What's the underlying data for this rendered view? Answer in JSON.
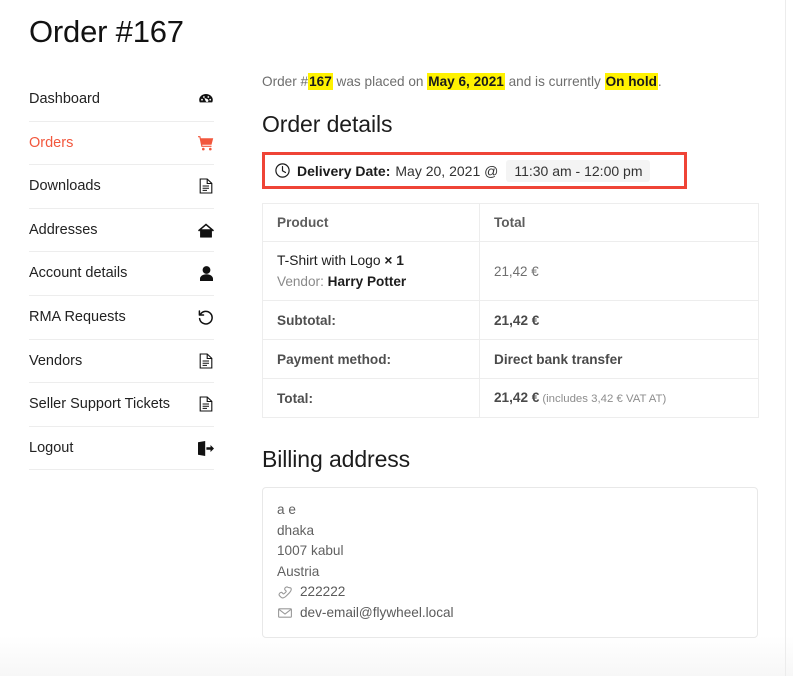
{
  "page_title": "Order #167",
  "sidebar": {
    "items": [
      {
        "label": "Dashboard",
        "icon": "dashboard-icon",
        "active": false
      },
      {
        "label": "Orders",
        "icon": "cart-icon",
        "active": true
      },
      {
        "label": "Downloads",
        "icon": "document-icon",
        "active": false
      },
      {
        "label": "Addresses",
        "icon": "home-icon",
        "active": false
      },
      {
        "label": "Account details",
        "icon": "user-icon",
        "active": false
      },
      {
        "label": "RMA Requests",
        "icon": "undo-icon",
        "active": false
      },
      {
        "label": "Vendors",
        "icon": "document-icon",
        "active": false
      },
      {
        "label": "Seller Support Tickets",
        "icon": "document-icon",
        "active": false
      },
      {
        "label": "Logout",
        "icon": "logout-icon",
        "active": false
      }
    ]
  },
  "status": {
    "prefix": "Order #",
    "order_number": "167",
    "middle": " was placed on ",
    "date": "May 6, 2021",
    "connector": " and is currently ",
    "state": "On hold",
    "suffix": "."
  },
  "order_details": {
    "heading": "Order details",
    "delivery": {
      "icon": "clock-icon",
      "label": "Delivery Date:",
      "date": "May 20, 2021 @",
      "time_range": "11:30 am - 12:00 pm"
    },
    "table": {
      "headers": [
        "Product",
        "Total"
      ],
      "product_row": {
        "name": "T-Shirt with Logo",
        "quantity": "× 1",
        "vendor_label": "Vendor:",
        "vendor_name": "Harry Potter",
        "total": "21,42 €"
      },
      "summary_rows": [
        {
          "label": "Subtotal:",
          "value": "21,42 €",
          "note": ""
        },
        {
          "label": "Payment method:",
          "value": "Direct bank transfer",
          "note": ""
        },
        {
          "label": "Total:",
          "value": "21,42 €",
          "note": "(includes 3,42 € VAT AT)"
        }
      ]
    }
  },
  "billing": {
    "heading": "Billing address",
    "lines": [
      "a e",
      "dhaka",
      "1007 kabul",
      "Austria"
    ],
    "phone": "222222",
    "email": "dev-email@flywheel.local"
  },
  "colors": {
    "accent": "#f2573d",
    "callout_border": "#ef4436",
    "highlight": "#fff200"
  }
}
